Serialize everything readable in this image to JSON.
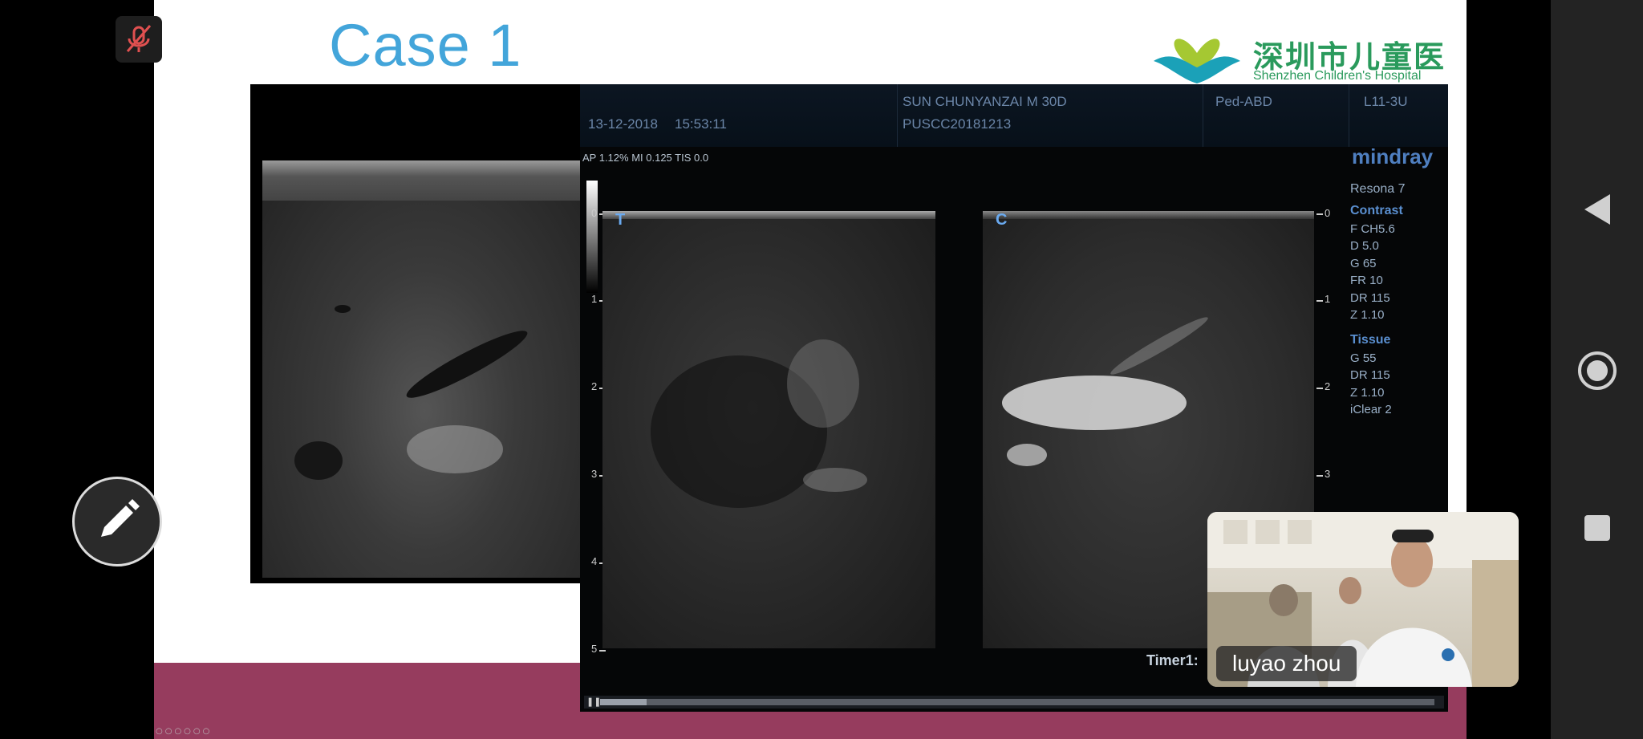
{
  "slide": {
    "title": "Case 1",
    "logo": {
      "chinese": "深圳市儿童医院",
      "english": "Shenzhen Children's Hospital"
    }
  },
  "ultrasound": {
    "date": "13-12-2018",
    "time": "15:53:11",
    "patient": "SUN CHUNYANZAI M 30D",
    "patient_id": "PUSCC20181213",
    "preset": "Ped-ABD",
    "probe": "L11-3U",
    "ap_line": "AP 1.12%  MI 0.125 TIS 0.0",
    "brand": "mindray",
    "model": "Resona 7",
    "contrast": {
      "heading": "Contrast",
      "rows": [
        "F CH5.6",
        "D 5.0",
        "G 65",
        "FR 10",
        "DR 115",
        "Z 1.10"
      ]
    },
    "tissue": {
      "heading": "Tissue",
      "rows": [
        "G 55",
        "DR 115",
        "Z 1.10",
        "iClear 2"
      ]
    },
    "depth_scale": [
      "0",
      "1",
      "2",
      "3",
      "4",
      "5"
    ],
    "right_scale": [
      "0",
      "1",
      "2",
      "3"
    ],
    "left_marker": "T",
    "right_marker": "C",
    "timer_label": "Timer1:",
    "playback_progress": 0.056
  },
  "video": {
    "participant": "luyao zhou"
  },
  "colors": {
    "title_blue": "#43a5da",
    "band_maroon": "#963c5e",
    "logo_green": "#2a9a5c",
    "brand_blue": "#4f7fc0"
  }
}
